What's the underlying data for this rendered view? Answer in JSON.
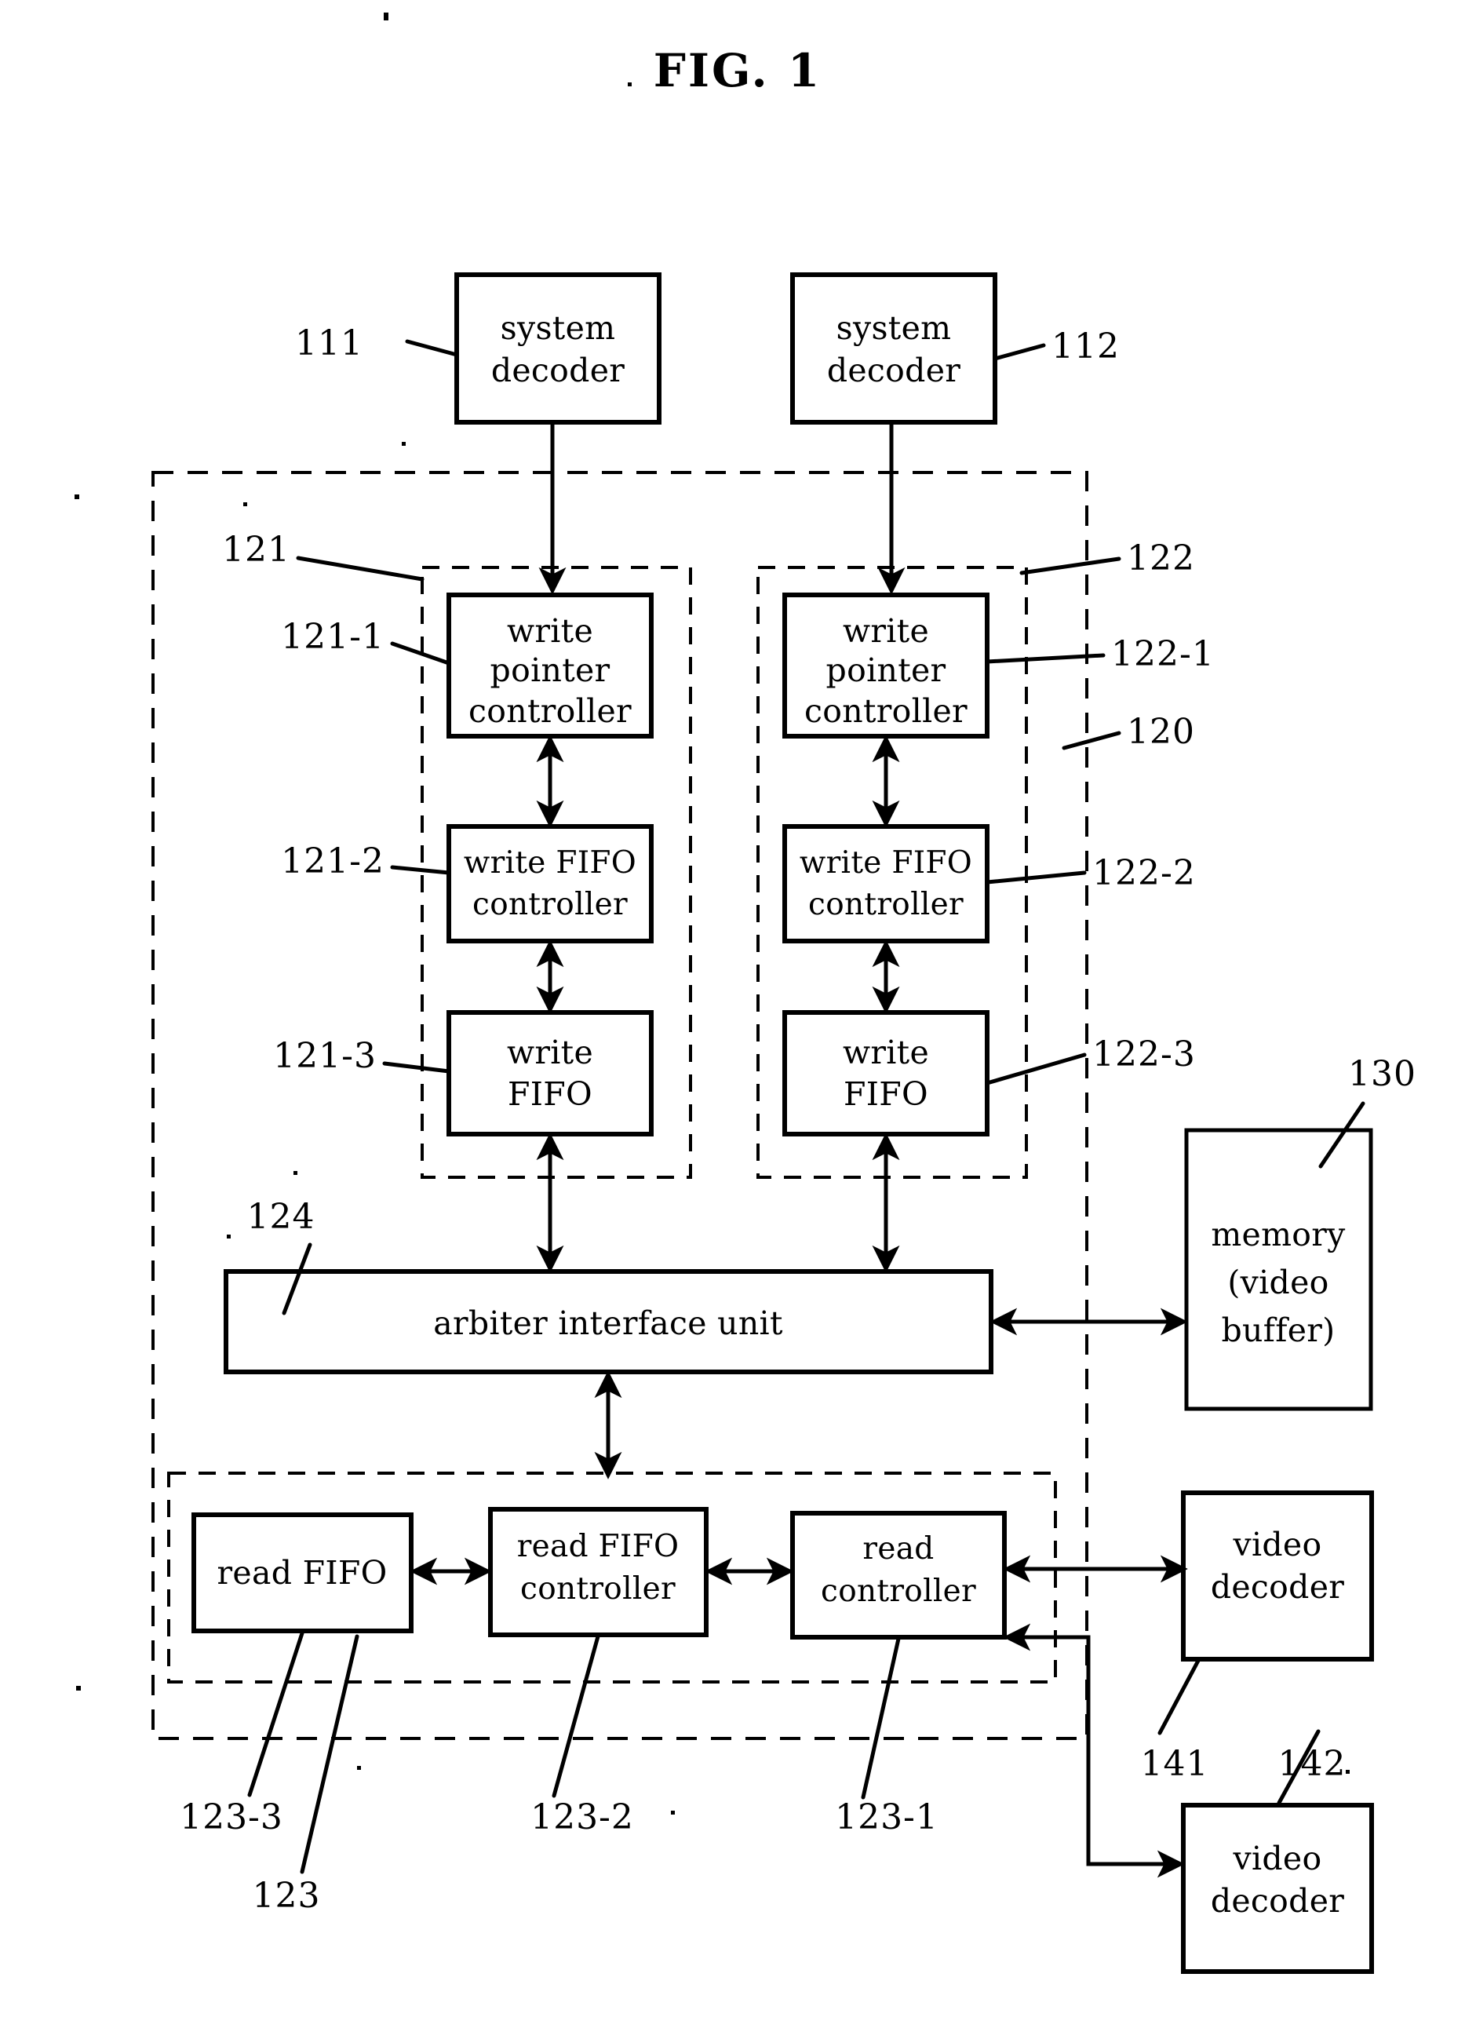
{
  "figure": {
    "title": "FIG. 1",
    "type": "patent-block-diagram"
  },
  "blocks": {
    "system_decoder_1": {
      "label_line1": "system",
      "label_line2": "decoder",
      "ref": "111"
    },
    "system_decoder_2": {
      "label_line1": "system",
      "label_line2": "decoder",
      "ref": "112"
    },
    "write_pointer_controller_1": {
      "label_line1": "write",
      "label_line2": "pointer",
      "label_line3": "controller",
      "ref": "121-1"
    },
    "write_fifo_controller_1": {
      "label_line1": "write FIFO",
      "label_line2": "controller",
      "ref": "121-2"
    },
    "write_fifo_1": {
      "label_line1": "write",
      "label_line2": "FIFO",
      "ref": "121-3"
    },
    "write_pointer_controller_2": {
      "label_line1": "write",
      "label_line2": "pointer",
      "label_line3": "controller",
      "ref": "122-1"
    },
    "write_fifo_controller_2": {
      "label_line1": "write FIFO",
      "label_line2": "controller",
      "ref": "122-2"
    },
    "write_fifo_2": {
      "label_line1": "write",
      "label_line2": "FIFO",
      "ref": "122-3"
    },
    "arbiter_interface_unit": {
      "label": "arbiter interface unit",
      "ref": "124"
    },
    "memory_video_buffer": {
      "label_line1": "memory",
      "label_line2": "(video",
      "label_line3": "buffer)",
      "ref": "130"
    },
    "read_fifo": {
      "label": "read FIFO",
      "ref": "123-3"
    },
    "read_fifo_controller": {
      "label_line1": "read FIFO",
      "label_line2": "controller",
      "ref": "123-2"
    },
    "read_controller": {
      "label_line1": "read",
      "label_line2": "controller",
      "ref": "123-1"
    },
    "video_decoder_1": {
      "label_line1": "video",
      "label_line2": "decoder",
      "ref": "141"
    },
    "video_decoder_2": {
      "label_line1": "video",
      "label_line2": "decoder",
      "ref": "142"
    }
  },
  "groups": {
    "write_group_1": {
      "ref": "121"
    },
    "write_group_2": {
      "ref": "122"
    },
    "read_group": {
      "ref": "123"
    },
    "outer_group": {
      "ref": "120"
    }
  },
  "colors": {
    "ink": "#000000",
    "paper": "#ffffff"
  }
}
